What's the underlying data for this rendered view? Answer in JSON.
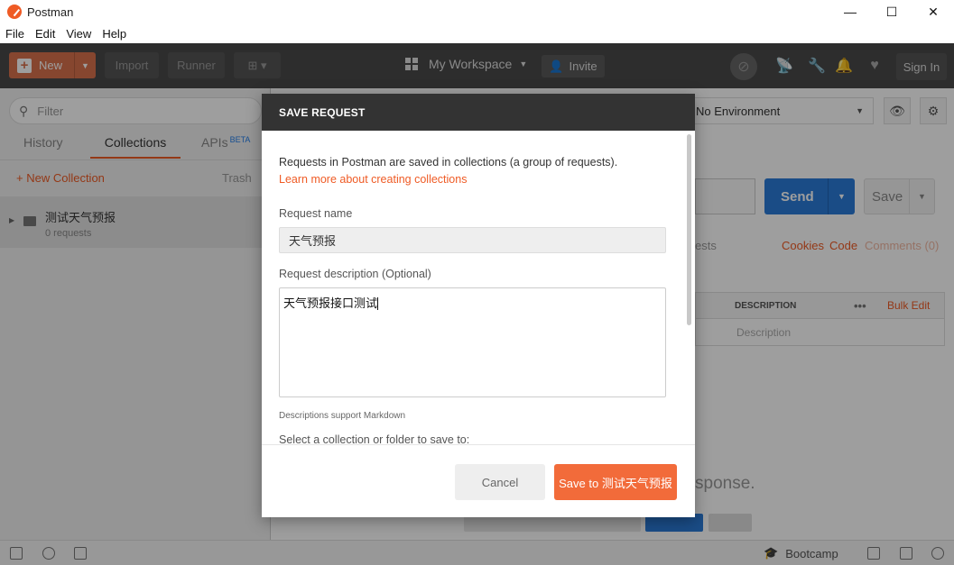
{
  "window": {
    "title": "Postman",
    "controls": [
      "—",
      "☐",
      "✕"
    ]
  },
  "menu": [
    "File",
    "Edit",
    "View",
    "Help"
  ],
  "toolbar": {
    "new_label": "New",
    "import_label": "Import",
    "runner_label": "Runner",
    "workspace_label": "My Workspace",
    "invite_label": "Invite",
    "signin_label": "Sign In"
  },
  "sidebar": {
    "filter_placeholder": "Filter",
    "tabs": {
      "history": "History",
      "collections": "Collections",
      "apis": "APIs",
      "beta": "BETA"
    },
    "new_collection": "+ New Collection",
    "trash": "Trash",
    "collection": {
      "name": "测试天气预报",
      "count": "0 requests"
    }
  },
  "main": {
    "environment": "No Environment",
    "send_label": "Send",
    "save_label": "Save",
    "links": {
      "tests": "ests",
      "cookies": "Cookies",
      "code": "Code",
      "comments": "Comments (0)"
    },
    "table": {
      "header": "DESCRIPTION",
      "bulk_edit": "Bulk Edit",
      "placeholder": "Description"
    },
    "response_text": "sponse."
  },
  "status_bar": {
    "bootcamp": "Bootcamp"
  },
  "modal": {
    "title": "SAVE REQUEST",
    "intro": "Requests in Postman are saved in collections (a group of requests).",
    "learn_more": "Learn more about creating collections",
    "name_label": "Request name",
    "name_value": "天气预报",
    "desc_label": "Request description (Optional)",
    "desc_value": "天气预报接口测试",
    "markdown_note": "Descriptions support Markdown",
    "select_label": "Select a collection or folder to save to:",
    "cancel_label": "Cancel",
    "save_to_label": "Save to 测试天气预报"
  },
  "colors": {
    "accent": "#ef5b25",
    "send": "#2a7bd8",
    "header_bg": "#4a4a4a"
  }
}
